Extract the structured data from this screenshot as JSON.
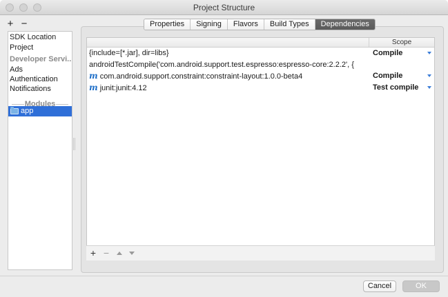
{
  "window": {
    "title": "Project Structure"
  },
  "left_toolbar": {
    "add": "+",
    "remove": "−"
  },
  "sidebar": {
    "items": [
      {
        "label": "SDK Location"
      },
      {
        "label": "Project"
      },
      {
        "label": "Developer Servi..."
      },
      {
        "label": "Ads"
      },
      {
        "label": "Authentication"
      },
      {
        "label": "Notifications"
      }
    ],
    "modules_header": "Modules",
    "selected_module": "app"
  },
  "tabs": [
    {
      "label": "Properties"
    },
    {
      "label": "Signing"
    },
    {
      "label": "Flavors"
    },
    {
      "label": "Build Types"
    },
    {
      "label": "Dependencies",
      "active": true
    }
  ],
  "dependencies": {
    "scope_header": "Scope",
    "rows": [
      {
        "name": "{include=[*.jar], dir=libs}",
        "scope": "Compile",
        "maven": false,
        "has_dropdown": true
      },
      {
        "name": "androidTestCompile('com.android.support.test.espresso:espresso-core:2.2.2', {",
        "scope": "",
        "maven": false,
        "has_dropdown": false
      },
      {
        "name": "com.android.support.constraint:constraint-layout:1.0.0-beta4",
        "scope": "Compile",
        "maven": true,
        "has_dropdown": true
      },
      {
        "name": "junit:junit:4.12",
        "scope": "Test compile",
        "maven": true,
        "has_dropdown": true
      }
    ],
    "maven_icon": "m"
  },
  "table_toolbar": {
    "add": "+",
    "remove": "−"
  },
  "buttons": {
    "cancel": "Cancel",
    "ok": "OK"
  },
  "colors": {
    "selection": "#2f6fd8",
    "active_tab": "#5f5f5f",
    "maven_icon": "#1f6fc8"
  }
}
